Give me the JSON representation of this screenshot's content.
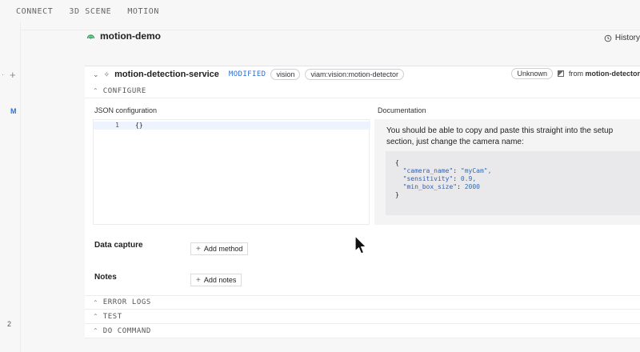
{
  "topnav": {
    "connect": "CONNECT",
    "scene": "3D SCENE",
    "motion": "MOTION"
  },
  "gutter": {
    "dot": "·",
    "plus": "+",
    "marker": "M",
    "count": "2"
  },
  "resource": {
    "name": "motion-demo",
    "history": "History"
  },
  "service": {
    "name": "motion-detection-service",
    "status": "MODIFIED",
    "chip_type": "vision",
    "chip_model": "viam:vision:motion-detector",
    "state": "Unknown",
    "from_label": "from",
    "from_name": "motion-detector"
  },
  "sections": {
    "configure": "CONFIGURE",
    "error_logs": "ERROR LOGS",
    "test": "TEST",
    "do_command": "DO COMMAND"
  },
  "json_config": {
    "title": "JSON configuration",
    "line_no": "1",
    "code": "{}"
  },
  "documentation": {
    "title": "Documentation",
    "text": "You should be able to copy and paste this straight into the setup section, just change the camera name:",
    "code_open": "{",
    "lines": [
      {
        "key": "\"camera_name\"",
        "value": "\"myCam\","
      },
      {
        "key": "\"sensitivity\"",
        "value": "0.9,"
      },
      {
        "key": "\"min_box_size\"",
        "value": "2000"
      }
    ],
    "code_close": "}"
  },
  "data_capture": {
    "label": "Data capture",
    "button": "Add method"
  },
  "notes": {
    "label": "Notes",
    "button": "Add notes"
  }
}
